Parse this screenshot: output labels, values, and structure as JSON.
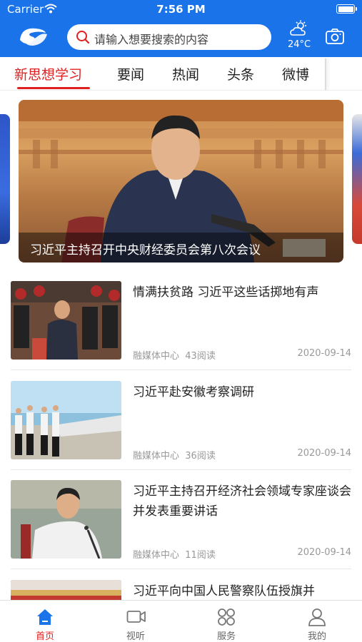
{
  "status_bar": {
    "carrier": "Carrier",
    "time": "7:56 PM"
  },
  "header": {
    "search_placeholder": "请输入想要搜索的内容",
    "temperature": "24°C",
    "brand_color": "#1a73e8"
  },
  "tabs": [
    {
      "label": "新思想学习",
      "active": true
    },
    {
      "label": "要闻",
      "active": false
    },
    {
      "label": "热闻",
      "active": false
    },
    {
      "label": "头条",
      "active": false
    },
    {
      "label": "微博",
      "active": false
    }
  ],
  "accent_color": "#e02020",
  "carousel": {
    "caption": "习近平主持召开中央财经委员会第八次会议"
  },
  "news": [
    {
      "title": "情满扶贫路 习近平这些话掷地有声",
      "source": "融媒体中心",
      "reads": "43阅读",
      "date": "2020-09-14"
    },
    {
      "title": "习近平赴安徽考察调研",
      "source": "融媒体中心",
      "reads": "36阅读",
      "date": "2020-09-14"
    },
    {
      "title": "习近平主持召开经济社会领域专家座谈会并发表重要讲话",
      "source": "融媒体中心",
      "reads": "11阅读",
      "date": "2020-09-14"
    },
    {
      "title": "习近平向中国人民警察队伍授旗并",
      "source": "",
      "reads": "",
      "date": ""
    }
  ],
  "bottom_nav": [
    {
      "label": "首页",
      "icon": "home-icon",
      "active": true
    },
    {
      "label": "视听",
      "icon": "video-icon",
      "active": false
    },
    {
      "label": "服务",
      "icon": "services-grid-icon",
      "active": false
    },
    {
      "label": "我的",
      "icon": "profile-icon",
      "active": false
    }
  ]
}
